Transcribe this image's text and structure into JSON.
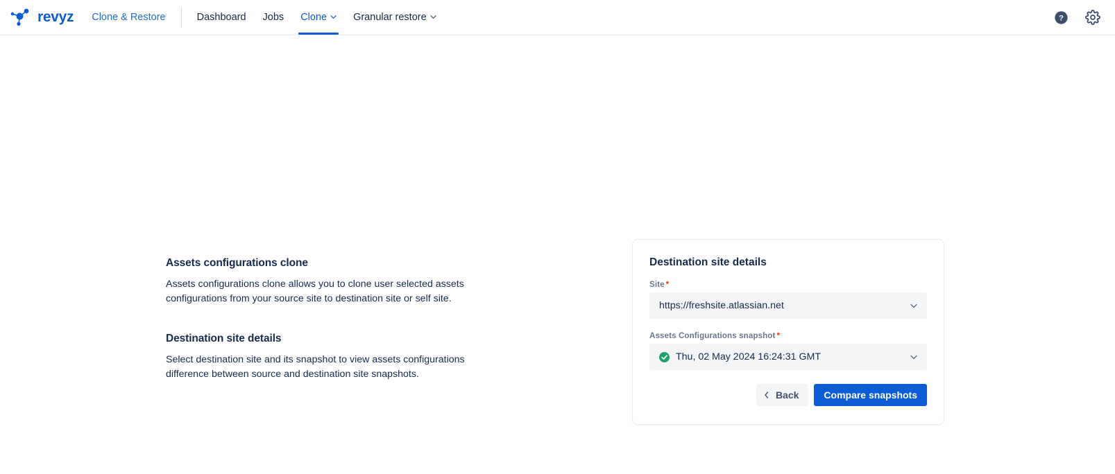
{
  "header": {
    "brand": {
      "name": "revyz",
      "icon": "molecule-logo-icon"
    },
    "primary_link": "Clone & Restore",
    "nav_items": [
      {
        "label": "Dashboard",
        "active": false,
        "has_caret": false
      },
      {
        "label": "Jobs",
        "active": false,
        "has_caret": false
      },
      {
        "label": "Clone",
        "active": true,
        "has_caret": true
      },
      {
        "label": "Granular restore",
        "active": false,
        "has_caret": true
      }
    ],
    "actions": [
      {
        "name": "help-icon",
        "glyph": "?"
      },
      {
        "name": "gear-icon",
        "glyph": "⚙"
      }
    ]
  },
  "left": {
    "section1_title": "Assets configurations clone",
    "section1_body": "Assets configurations clone allows you to clone user selected assets configurations from your source site to destination site or self site.",
    "section2_title": "Destination site details",
    "section2_body": "Select destination site and its snapshot to view assets configurations difference between source and destination site snapshots."
  },
  "card": {
    "title": "Destination site details",
    "site_field": {
      "label": "Site",
      "required_marker": "*",
      "value": "https://freshsite.atlassian.net"
    },
    "snapshot_field": {
      "label": "Assets Configurations snapshot",
      "required_marker": "*",
      "value": "Thu, 02 May 2024 16:24:31 GMT",
      "status_icon": "success-check-icon"
    },
    "back_button": "Back",
    "compare_button": "Compare snapshots"
  },
  "colors": {
    "brand_blue": "#0b5cd5",
    "link_blue": "#1f6fe0",
    "text_dark": "#172b4d",
    "label_gray": "#6b778c",
    "field_bg": "#f4f5f7",
    "required_red": "#de350b",
    "success_green": "#22a06b",
    "border": "#ebecf0"
  }
}
